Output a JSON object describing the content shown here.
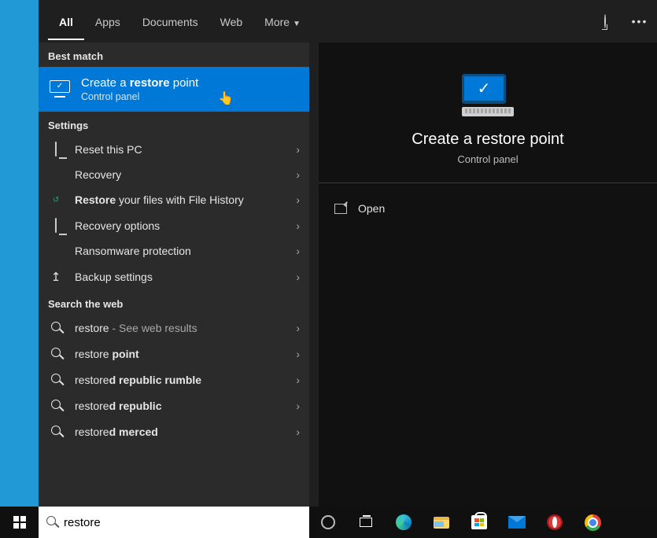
{
  "tabs": {
    "all": "All",
    "apps": "Apps",
    "documents": "Documents",
    "web": "Web",
    "more": "More"
  },
  "sections": {
    "best_match": "Best match",
    "settings": "Settings",
    "search_web": "Search the web"
  },
  "best_match": {
    "title_pre": "Create a ",
    "title_bold": "restore",
    "title_post": " point",
    "subtitle": "Control panel"
  },
  "settings_list": [
    {
      "icon": "syspro",
      "label": "Reset this PC"
    },
    {
      "icon": "recovery",
      "label": "Recovery"
    },
    {
      "icon": "filehist",
      "label_pre": "",
      "label_bold": "Restore",
      "label_post": " your files with File History"
    },
    {
      "icon": "syspro",
      "label": "Recovery options"
    },
    {
      "icon": "shield",
      "label": "Ransomware protection"
    },
    {
      "icon": "uparrow",
      "label": "Backup settings"
    }
  ],
  "web_list": [
    {
      "term": "restore",
      "suffix": " - See web results",
      "bold_suffix": ""
    },
    {
      "term": "restore ",
      "bold_suffix": "point"
    },
    {
      "term": "restore",
      "bold_suffix": "d republic rumble"
    },
    {
      "term": "restore",
      "bold_suffix": "d republic"
    },
    {
      "term": "restore",
      "bold_suffix": "d merced"
    }
  ],
  "preview": {
    "title": "Create a restore point",
    "subtitle": "Control panel",
    "open": "Open"
  },
  "search": {
    "value": "restore"
  }
}
